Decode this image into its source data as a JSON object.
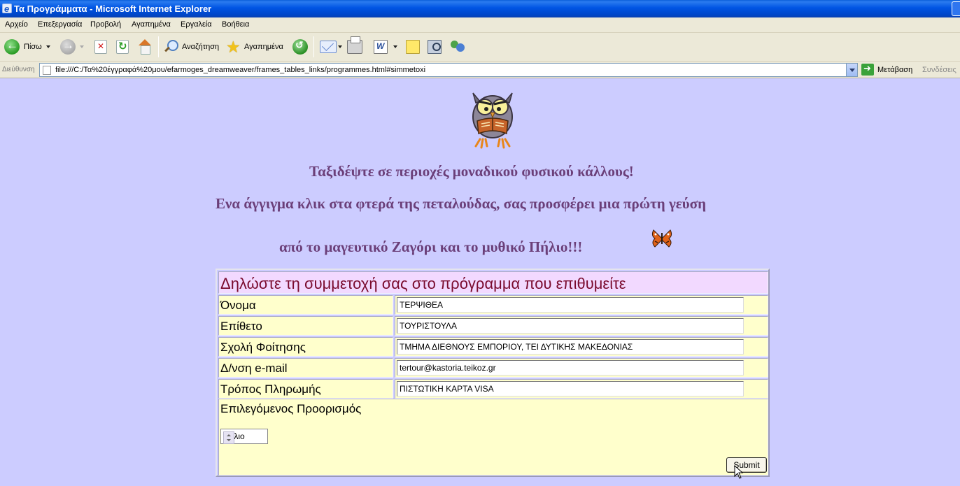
{
  "window": {
    "title": "Τα Προγράμματα - Microsoft Internet Explorer"
  },
  "menu": {
    "file": "Αρχείο",
    "edit": "Επεξεργασία",
    "view": "Προβολή",
    "favorites": "Αγαπημένα",
    "tools": "Εργαλεία",
    "help": "Βοήθεια"
  },
  "toolbar": {
    "back": "Πίσω",
    "search": "Αναζήτηση",
    "favorites": "Αγαπημένα"
  },
  "address": {
    "label": "Διεύθυνση",
    "url": "file:///C:/Τα%20έγγραφά%20μου/efarmoges_dreamweaver/frames_tables_links/programmes.html#simmetoxi",
    "go": "Μετάβαση",
    "links": "Συνδέσεις"
  },
  "page": {
    "headline1": "Ταξιδέψτε σε περιοχές μοναδικού φυσικού κάλλους!",
    "headline2": "Ενα άγγιγμα κλικ στα φτερά της πεταλούδας, σας προσφέρει μια πρώτη γεύση",
    "headline3": "από το μαγευτικό Ζαγόρι και το μυθικό Πήλιο!!!"
  },
  "form": {
    "heading": "Δηλώστε τη συμμετοχή σας στο πρόγραμμα που επιθυμείτε",
    "fields": [
      {
        "label": "Όνομα",
        "value": "ΤΕΡΨΙΘΕΑ"
      },
      {
        "label": "Επίθετο",
        "value": "ΤΟΥΡΙΣΤΟΥΛΑ"
      },
      {
        "label": "Σχολή Φοίτησης",
        "value": "ΤΜΗΜΑ ΔΙΕΘΝΟΥΣ ΕΜΠΟΡΙΟΥ, ΤΕΙ ΔΥΤΙΚΗΣ ΜΑΚΕΔΟΝΙΑΣ"
      },
      {
        "label": "Δ/νση e-mail",
        "value": "tertour@kastoria.teikoz.gr"
      },
      {
        "label": "Τρόπος Πληρωμής",
        "value": "ΠΙΣΤΩΤΙΚΗ ΚΑΡΤΑ  VISA"
      }
    ],
    "destination_label": "Επιλεγόμενος Προορισμός",
    "destination_value": "Πήλιο",
    "submit": "Submit"
  }
}
